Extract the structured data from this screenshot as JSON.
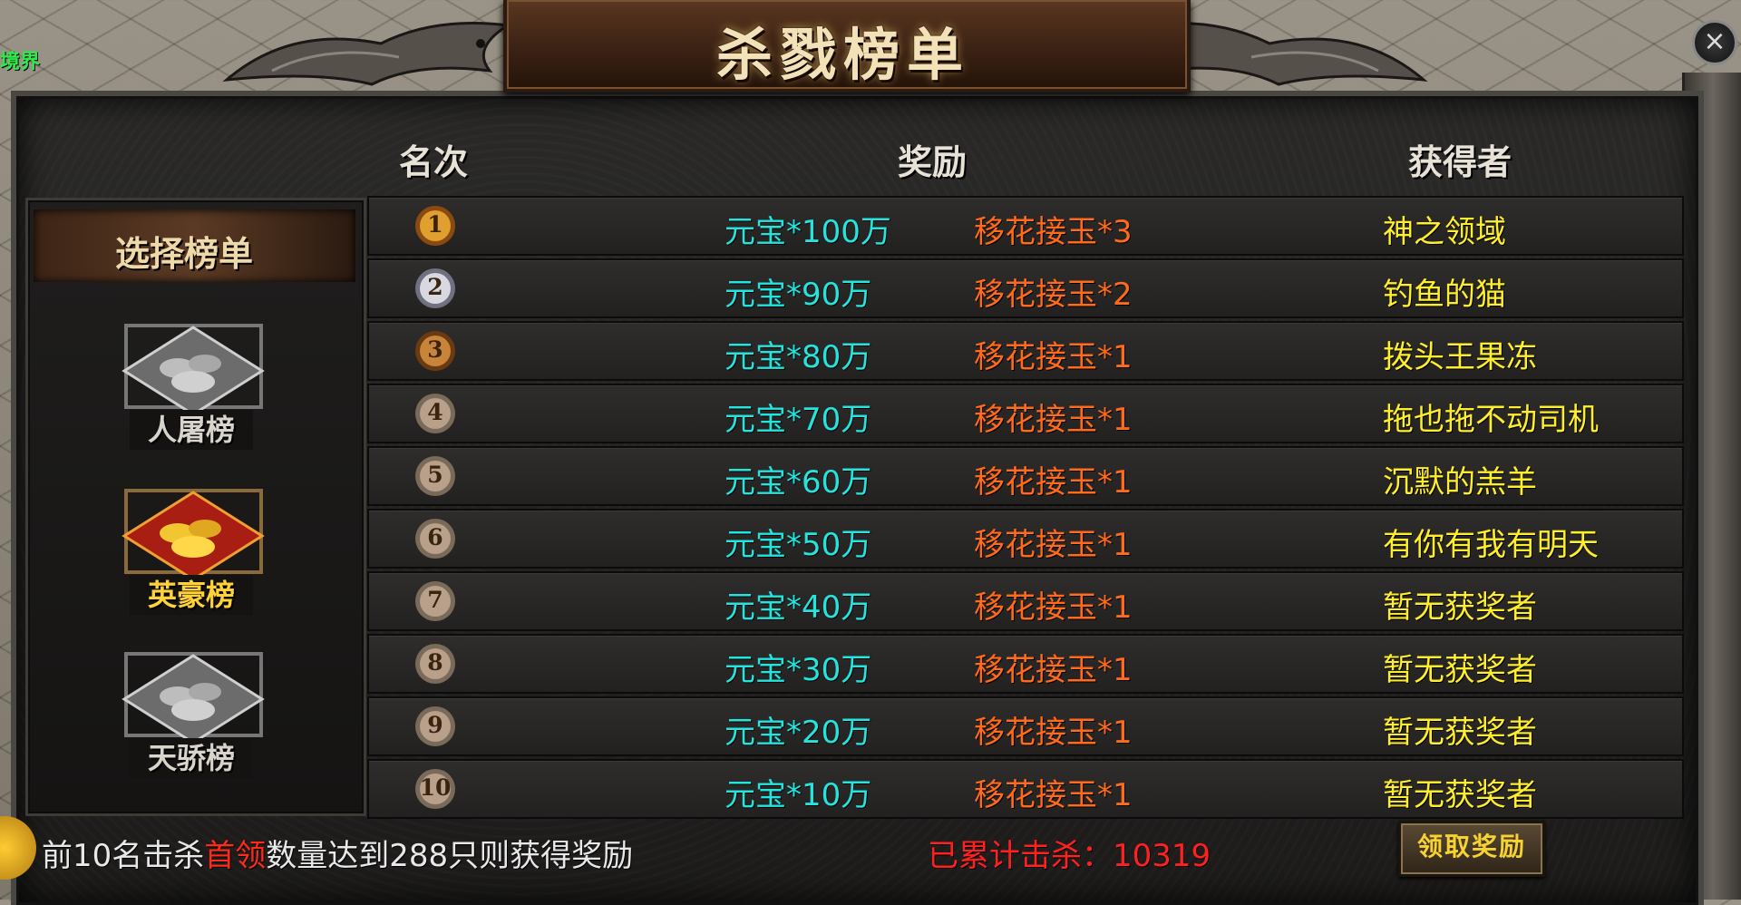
{
  "realm_text": "境界",
  "title": "杀戮榜单",
  "columns": {
    "rank": "名次",
    "reward": "奖励",
    "winner": "获得者"
  },
  "side": {
    "title": "选择榜单",
    "boards": [
      {
        "label": "人屠榜"
      },
      {
        "label": "英豪榜"
      },
      {
        "label": "天骄榜"
      }
    ]
  },
  "rows": [
    {
      "rank": "1",
      "gold": "元宝*100万",
      "item": "移花接玉*3",
      "winner": "神之领域"
    },
    {
      "rank": "2",
      "gold": "元宝*90万",
      "item": "移花接玉*2",
      "winner": "钓鱼的猫"
    },
    {
      "rank": "3",
      "gold": "元宝*80万",
      "item": "移花接玉*1",
      "winner": "拨头王果冻"
    },
    {
      "rank": "4",
      "gold": "元宝*70万",
      "item": "移花接玉*1",
      "winner": "拖也拖不动司机"
    },
    {
      "rank": "5",
      "gold": "元宝*60万",
      "item": "移花接玉*1",
      "winner": "沉默的羔羊"
    },
    {
      "rank": "6",
      "gold": "元宝*50万",
      "item": "移花接玉*1",
      "winner": "有你有我有明天"
    },
    {
      "rank": "7",
      "gold": "元宝*40万",
      "item": "移花接玉*1",
      "winner": "暂无获奖者"
    },
    {
      "rank": "8",
      "gold": "元宝*30万",
      "item": "移花接玉*1",
      "winner": "暂无获奖者"
    },
    {
      "rank": "9",
      "gold": "元宝*20万",
      "item": "移花接玉*1",
      "winner": "暂无获奖者"
    },
    {
      "rank": "10",
      "gold": "元宝*10万",
      "item": "移花接玉*1",
      "winner": "暂无获奖者"
    }
  ],
  "footer": {
    "note_prefix": "前10名击杀",
    "note_highlight": "首领",
    "note_suffix": "数量达到288只则获得奖励",
    "kill_count": "已累计击杀：10319",
    "claim_button": "领取奖励"
  },
  "colors": {
    "gold_text": "#25e3dd",
    "item_text": "#ff6a1c",
    "winner_text": "#ffee2e",
    "active_board": "#ffd23a",
    "kill_count": "#ff2020"
  },
  "icons": {
    "close": "close-icon",
    "medal": "rank-medal-icon",
    "board": "treasure-pile-icon"
  }
}
